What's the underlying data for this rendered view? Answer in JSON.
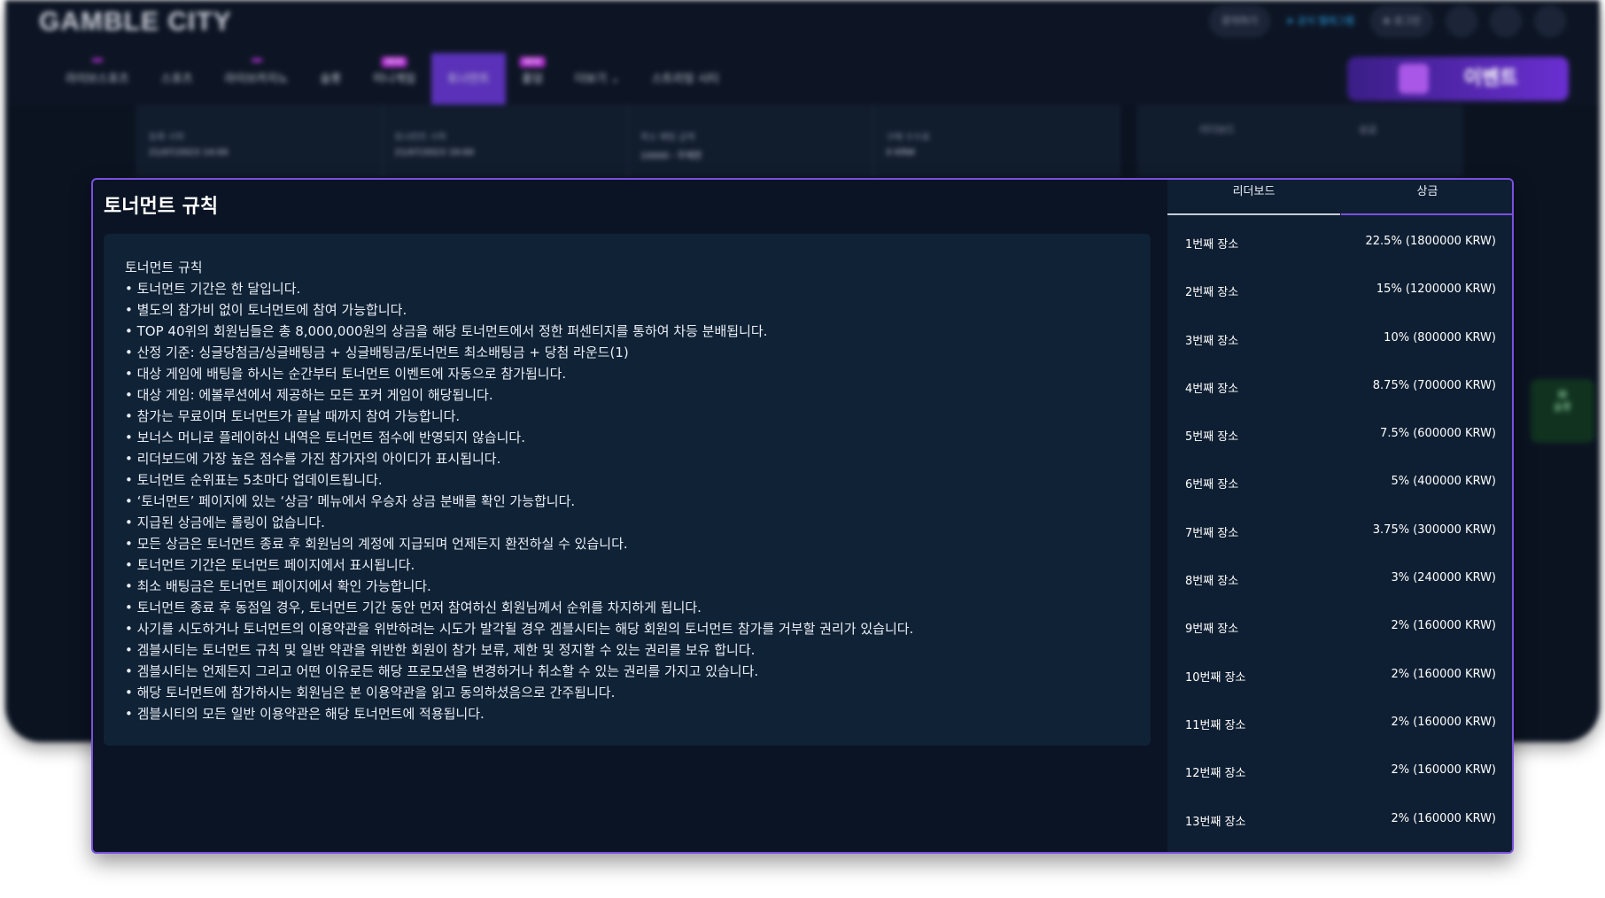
{
  "background": {
    "logo": "GAMBLE CITY",
    "nav": [
      {
        "label": "라이브스포츠",
        "badge": ""
      },
      {
        "label": "스포츠",
        "badge": ""
      },
      {
        "label": "라이브카지노",
        "badge": ""
      },
      {
        "label": "슬롯",
        "badge": ""
      },
      {
        "label": "미니게임",
        "badge": "NEW"
      },
      {
        "label": "토너먼트",
        "badge": ""
      },
      {
        "label": "홀덤",
        "badge": "NEW"
      },
      {
        "label": "더보기",
        "badge": ""
      },
      {
        "label": "스트리밍 시티",
        "badge": ""
      }
    ],
    "event_button": "이벤트",
    "topright": {
      "chat": "문의하기",
      "telegram": "공식 텔레그램",
      "login": "로그인"
    },
    "info": [
      {
        "label": "등록 시작",
        "value": "21/07/2023 14:00"
      },
      {
        "label": "토너먼트 시작",
        "value": "21/07/2023 19:00"
      },
      {
        "label": "최소 배팅 금액",
        "value": "10000 - 무제한"
      },
      {
        "label": "구매 수수료",
        "value": "0 KRW"
      }
    ],
    "right_tabs": [
      "리더보드",
      "상금"
    ],
    "side_widget": "슬롯"
  },
  "modal": {
    "title": "토너먼트 규칙",
    "rules_heading": "토너먼트 규칙",
    "rules": [
      "• 토너먼트 기간은 한 달입니다.",
      "• 별도의 참가비 없이 토너먼트에 참여 가능합니다.",
      "• TOP 40위의 회원님들은 총 8,000,000원의 상금을 해당 토너먼트에서 정한 퍼센티지를 통하여 차등 분배됩니다.",
      "• 산정 기준: 싱글당첨금/싱글배팅금 + 싱글배팅금/토너먼트 최소배팅금 + 당첨 라운드(1)",
      "• 대상 게임에 배팅을 하시는 순간부터 토너먼트 이벤트에 자동으로 참가됩니다.",
      "• 대상 게임: 에볼루션에서 제공하는 모든 포커 게임이 해당됩니다.",
      "• 참가는 무료이며 토너먼트가 끝날 때까지 참여 가능합니다.",
      "• 보너스 머니로 플레이하신 내역은 토너먼트 점수에 반영되지 않습니다.",
      "• 리더보드에 가장 높은 점수를 가진 참가자의 아이디가 표시됩니다.",
      "• 토너먼트 순위표는 5초마다 업데이트됩니다.",
      "• ‘토너먼트’ 페이지에 있는 ‘상금’ 메뉴에서 우승자 상금 분배를 확인 가능합니다.",
      "• 지급된 상금에는 롤링이 없습니다.",
      "• 모든 상금은 토너먼트 종료 후 회원님의 계정에 지급되며 언제든지 환전하실 수 있습니다.",
      "• 토너먼트 기간은 토너먼트 페이지에서 표시됩니다.",
      "• 최소 배팅금은 토너먼트 페이지에서 확인 가능합니다.",
      "• 토너먼트 종료 후 동점일 경우, 토너먼트 기간 동안 먼저 참여하신 회원님께서 순위를 차지하게 됩니다.",
      "• 사기를 시도하거나 토너먼트의 이용약관을 위반하려는 시도가 발각될 경우 겜블시티는 해당 회원의 토너먼트 참가를 거부할 권리가 있습니다.",
      "• 겜블시티는 토너먼트 규칙 및 일반 약관을 위반한 회원이 참가 보류, 제한 및 정지할 수 있는 권리를 보유 합니다.",
      "• 겜블시티는 언제든지 그리고 어떤 이유로든 해당 프로모션을 변경하거나 취소할 수 있는 권리를 가지고 있습니다.",
      "• 해당 토너먼트에 참가하시는 회원님은 본 이용약관을 읽고 동의하셨음으로 간주됩니다.",
      "• 겜블시티의 모든 일반 이용약관은 해당 토너먼트에 적용됩니다."
    ],
    "tabs": {
      "leaderboard": "리더보드",
      "prize": "상금"
    },
    "prizes": [
      {
        "place": "1번째 장소",
        "amount": "22.5% (1800000 KRW)"
      },
      {
        "place": "2번째 장소",
        "amount": "15% (1200000 KRW)"
      },
      {
        "place": "3번째 장소",
        "amount": "10% (800000 KRW)"
      },
      {
        "place": "4번째 장소",
        "amount": "8.75% (700000 KRW)"
      },
      {
        "place": "5번째 장소",
        "amount": "7.5% (600000 KRW)"
      },
      {
        "place": "6번째 장소",
        "amount": "5% (400000 KRW)"
      },
      {
        "place": "7번째 장소",
        "amount": "3.75% (300000 KRW)"
      },
      {
        "place": "8번째 장소",
        "amount": "3% (240000 KRW)"
      },
      {
        "place": "9번째 장소",
        "amount": "2% (160000 KRW)"
      },
      {
        "place": "10번째 장소",
        "amount": "2% (160000 KRW)"
      },
      {
        "place": "11번째 장소",
        "amount": "2% (160000 KRW)"
      },
      {
        "place": "12번째 장소",
        "amount": "2% (160000 KRW)"
      },
      {
        "place": "13번째 장소",
        "amount": "2% (160000 KRW)"
      }
    ]
  }
}
